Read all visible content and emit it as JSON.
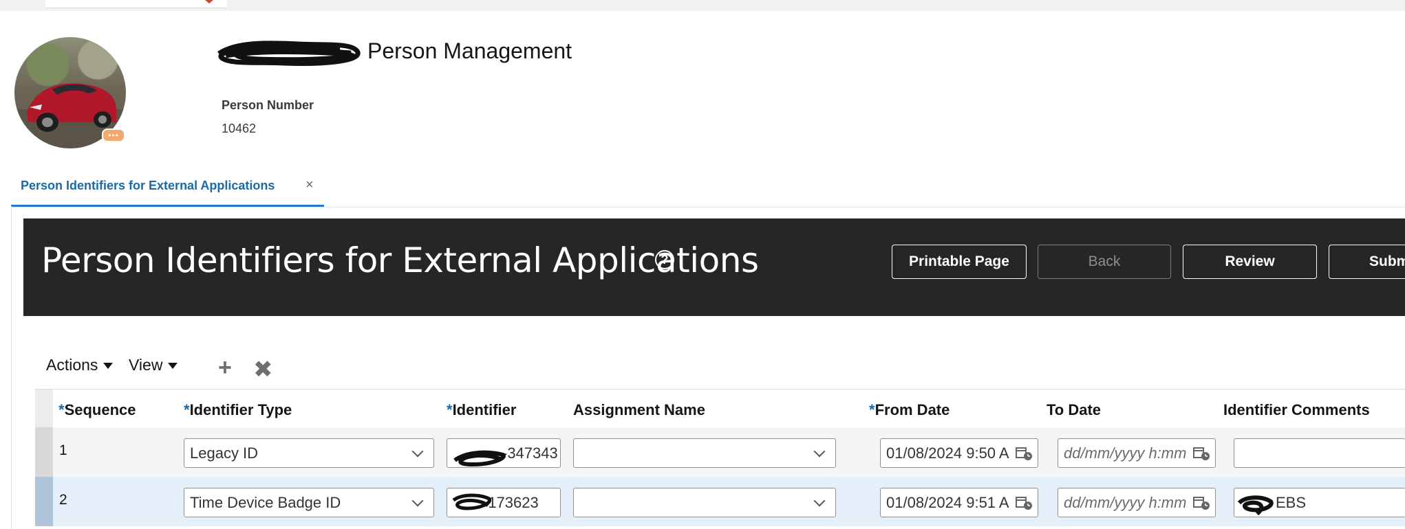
{
  "header": {
    "app_title": "Person Management",
    "person_number_label": "Person Number",
    "person_number": "10462",
    "avatar_badge": "•••"
  },
  "tab": {
    "label": "Person Identifiers for External Applications",
    "close": "×"
  },
  "page": {
    "title": "Person Identifiers for External Applications",
    "help": "?",
    "buttons": {
      "printable": "Printable Page",
      "back": "Back",
      "review": "Review",
      "submit": "Submit"
    }
  },
  "toolbar": {
    "actions": "Actions",
    "view": "View",
    "add": "+",
    "delete": "✖"
  },
  "table": {
    "required_mark": "*",
    "columns": {
      "sequence": "Sequence",
      "identifier_type": "Identifier Type",
      "identifier": "Identifier",
      "assignment_name": "Assignment Name",
      "from_date": "From Date",
      "to_date": "To Date",
      "comments": "Identifier Comments"
    },
    "rows": [
      {
        "sequence": "1",
        "identifier_type": "Legacy ID",
        "identifier": "-347343",
        "assignment_name": "",
        "from_date": "01/08/2024 9:50 A",
        "to_date_placeholder": "dd/mm/yyyy h:mm",
        "comments": ""
      },
      {
        "sequence": "2",
        "identifier_type": "Time Device Badge ID",
        "identifier": "-173623",
        "assignment_name": "",
        "from_date": "01/08/2024 9:51 A",
        "to_date_placeholder": "dd/mm/yyyy h:mm",
        "comments": "EBS"
      }
    ]
  },
  "colors": {
    "accent": "#227ac8",
    "banner": "#262626",
    "selected_row": "#e4effa"
  }
}
